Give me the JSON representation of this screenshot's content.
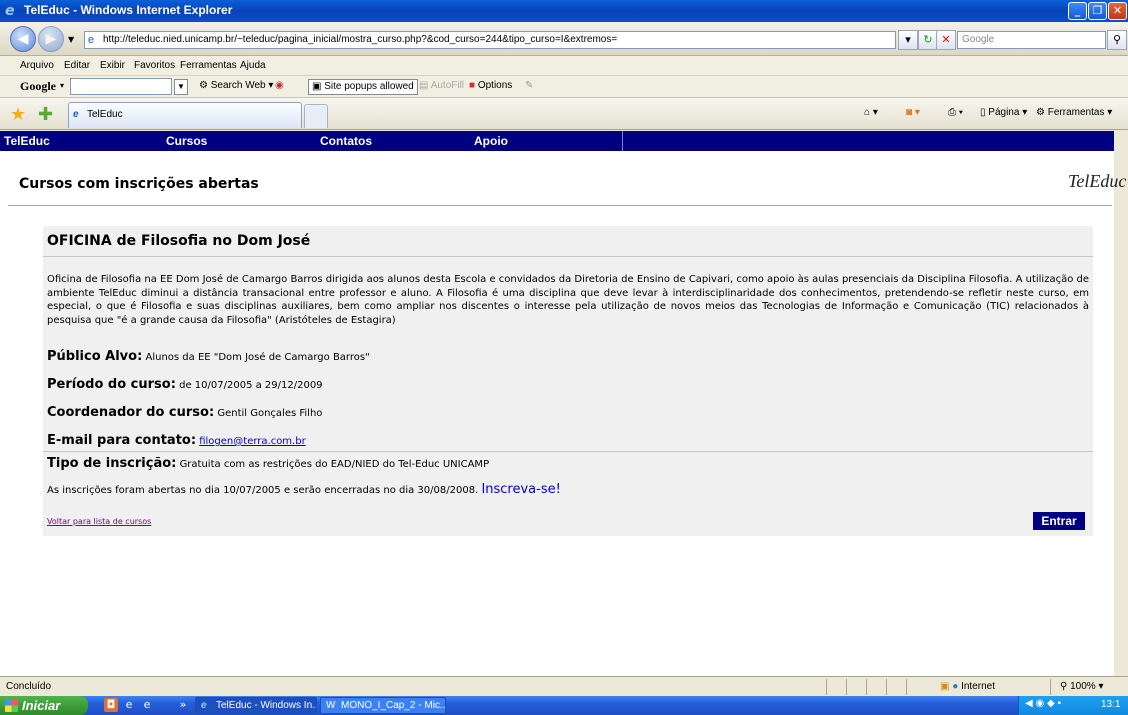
{
  "window": {
    "title": "TelEduc - Windows Internet Explorer",
    "minimize": "_",
    "maximize": "❐",
    "close": "✕"
  },
  "addressbar": {
    "url": "http://teleduc.nied.unicamp.br/~teleduc/pagina_inicial/mostra_curso.php?&cod_curso=244&tipo_curso=I&extremos=",
    "search_placeholder": "Google"
  },
  "menu": [
    "Arquivo",
    "Editar",
    "Exibir",
    "Favoritos",
    "Ferramentas",
    "Ajuda"
  ],
  "google_toolbar": {
    "logo": "Google",
    "search_web": "Search Web",
    "popups": "Site popups allowed",
    "autofill": "AutoFill",
    "options": "Options"
  },
  "tab": {
    "label": "TelEduc"
  },
  "commands": {
    "page": "Página",
    "tools": "Ferramentas"
  },
  "site_nav": [
    "TelEduc",
    "Cursos",
    "Contatos",
    "Apoio"
  ],
  "page": {
    "heading": "Cursos com inscrições abertas",
    "logo_text": "TelEduc"
  },
  "course": {
    "title": "OFICINA de Filosofia no Dom José",
    "description": "Oficina de Filosofia na EE Dom José de Camargo Barros dirigida aos alunos desta Escola e convidados da Diretoria de Ensino de Capivari, como apoio às aulas presenciais da Disciplina Filosofia. A utilização de ambiente TelEduc diminui a distância transacional entre professor e aluno. A Filosofia é uma disciplina que deve levar à interdisciplinaridade dos conhecimentos, pretendendo-se refletir neste curso, em especial, o que é Filosofia e suas disciplinas auxiliares, bem como ampliar nos discentes o interesse pela utilização de novos meios das Tecnologias de Informação e Comunicação (TIC) relacionados à pesquisa que \"é a grande causa da Filosofia\" (Aristóteles de Estagira)",
    "publico_label": "Público Alvo:",
    "publico_value": "Alunos da EE \"Dom José de Camargo Barros\"",
    "periodo_label": "Período do curso:",
    "periodo_value": "de 10/07/2005 a 29/12/2009",
    "coord_label": "Coordenador do curso:",
    "coord_value": "Gentil Gonçales Filho",
    "email_label": "E-mail para contato:",
    "email_value": "filogen@terra.com.br",
    "tipo_label": "Tipo de inscrição:",
    "tipo_value": "Gratuita com as restrições do EAD/NIED do Tel-Educ UNICAMP",
    "inscricoes_text": "As inscrições foram abertas no dia 10/07/2005 e serão encerradas no dia 30/08/2008.",
    "inscreva_link": "Inscreva-se!",
    "voltar_link": "Voltar para lista de cursos",
    "entrar_button": "Entrar"
  },
  "statusbar": {
    "status": "Concluído",
    "zone": "Internet",
    "zoom": "100%"
  },
  "taskbar": {
    "start": "Iniciar",
    "items": [
      "TelEduc - Windows In...",
      "MONO_I_Cap_2 - Mic..."
    ],
    "clock": "13:1"
  }
}
